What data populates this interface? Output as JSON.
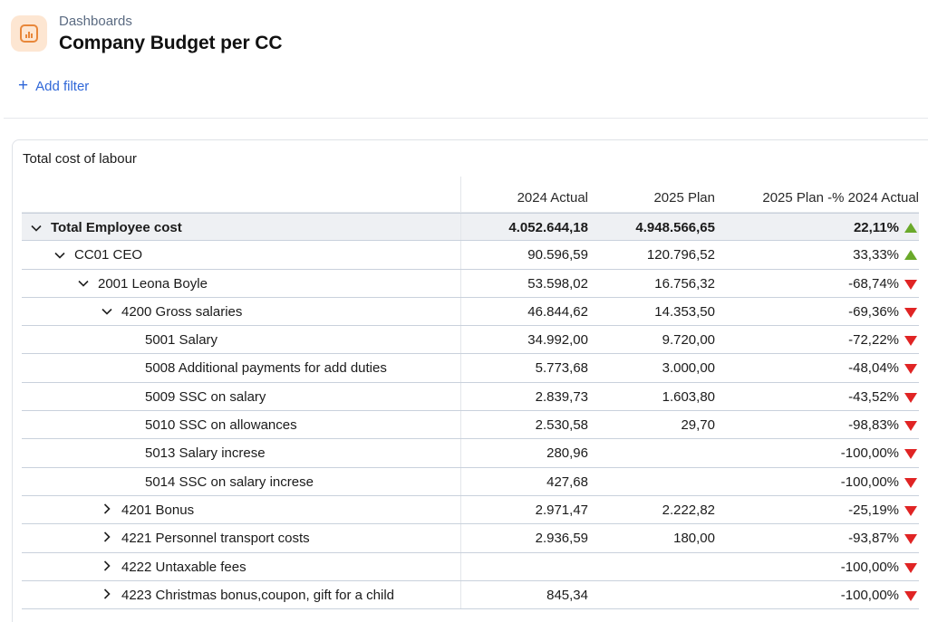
{
  "header": {
    "breadcrumb": "Dashboards",
    "title": "Company Budget per CC",
    "icon": "bar-chart-icon"
  },
  "filter": {
    "add_label": "Add filter"
  },
  "card": {
    "title": "Total cost of labour"
  },
  "table": {
    "columns": [
      "2024 Actual",
      "2025 Plan",
      "2025 Plan -% 2024 Actual"
    ],
    "rows": [
      {
        "label": "Total Employee cost",
        "level": 0,
        "expander": "expanded",
        "actual": "4.052.644,18",
        "plan": "4.948.566,65",
        "pct": "22,11%",
        "trend": "up"
      },
      {
        "label": "CC01 CEO",
        "level": 1,
        "expander": "expanded",
        "actual": "90.596,59",
        "plan": "120.796,52",
        "pct": "33,33%",
        "trend": "up"
      },
      {
        "label": "2001 Leona Boyle",
        "level": 2,
        "expander": "expanded",
        "actual": "53.598,02",
        "plan": "16.756,32",
        "pct": "-68,74%",
        "trend": "down"
      },
      {
        "label": "4200 Gross salaries",
        "level": 3,
        "expander": "expanded",
        "actual": "46.844,62",
        "plan": "14.353,50",
        "pct": "-69,36%",
        "trend": "down"
      },
      {
        "label": "5001 Salary",
        "level": 4,
        "expander": "none",
        "actual": "34.992,00",
        "plan": "9.720,00",
        "pct": "-72,22%",
        "trend": "down"
      },
      {
        "label": "5008 Additional payments for add duties",
        "level": 4,
        "expander": "none",
        "actual": "5.773,68",
        "plan": "3.000,00",
        "pct": "-48,04%",
        "trend": "down"
      },
      {
        "label": "5009 SSC on salary",
        "level": 4,
        "expander": "none",
        "actual": "2.839,73",
        "plan": "1.603,80",
        "pct": "-43,52%",
        "trend": "down"
      },
      {
        "label": "5010 SSC on allowances",
        "level": 4,
        "expander": "none",
        "actual": "2.530,58",
        "plan": "29,70",
        "pct": "-98,83%",
        "trend": "down"
      },
      {
        "label": "5013 Salary increse",
        "level": 4,
        "expander": "none",
        "actual": "280,96",
        "plan": "",
        "pct": "-100,00%",
        "trend": "down"
      },
      {
        "label": "5014 SSC on salary increse",
        "level": 4,
        "expander": "none",
        "actual": "427,68",
        "plan": "",
        "pct": "-100,00%",
        "trend": "down"
      },
      {
        "label": "4201 Bonus",
        "level": 3,
        "expander": "collapsed",
        "actual": "2.971,47",
        "plan": "2.222,82",
        "pct": "-25,19%",
        "trend": "down"
      },
      {
        "label": "4221 Personnel transport costs",
        "level": 3,
        "expander": "collapsed",
        "actual": "2.936,59",
        "plan": "180,00",
        "pct": "-93,87%",
        "trend": "down"
      },
      {
        "label": "4222 Untaxable fees",
        "level": 3,
        "expander": "collapsed",
        "actual": "",
        "plan": "",
        "pct": "-100,00%",
        "trend": "down"
      },
      {
        "label": "4223 Christmas bonus,coupon, gift for a child",
        "level": 3,
        "expander": "collapsed",
        "actual": "845,34",
        "plan": "",
        "pct": "-100,00%",
        "trend": "down"
      }
    ]
  },
  "colors": {
    "accent": "#2f67d8",
    "up": "#6aa92a",
    "down": "#e02424",
    "icon_bg": "#fde6d2",
    "icon_fg": "#e8873a"
  }
}
